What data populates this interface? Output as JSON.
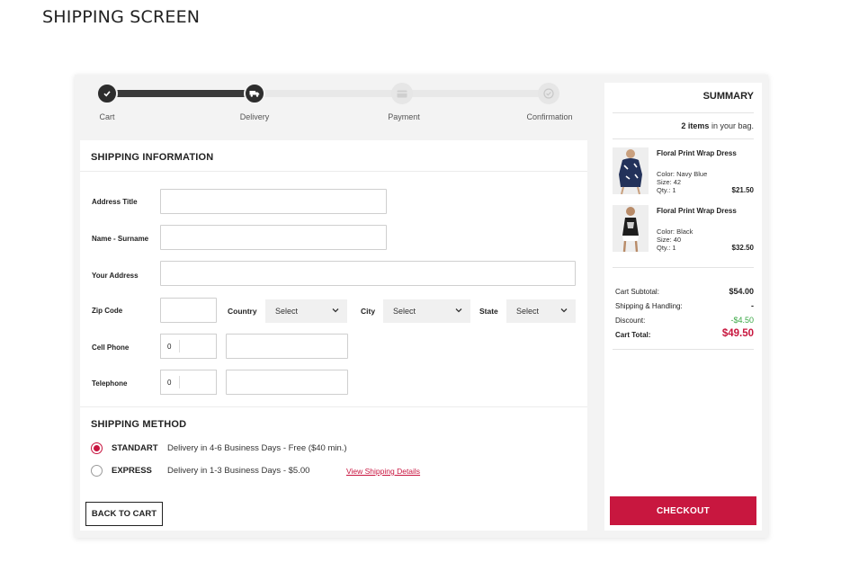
{
  "page": {
    "heading": "SHIPPING SCREEN"
  },
  "steps": [
    {
      "label": "Cart",
      "state": "done",
      "icon": "check-icon"
    },
    {
      "label": "Delivery",
      "state": "current",
      "icon": "truck-icon"
    },
    {
      "label": "Payment",
      "state": "todo",
      "icon": "credit-card-icon"
    },
    {
      "label": "Confirmation",
      "state": "todo",
      "icon": "check-circle-icon"
    }
  ],
  "shipping_info": {
    "title": "SHIPPING INFORMATION",
    "address_title_label": "Address Title",
    "address_title_value": "",
    "name_label": "Name - Surname",
    "name_value": "",
    "address_label": "Your Address",
    "address_value": "",
    "zip_label": "Zip Code",
    "zip_value": "",
    "country_label": "Country",
    "country_value": "Select",
    "city_label": "City",
    "city_value": "Select",
    "state_label": "State",
    "state_value": "Select",
    "cell_label": "Cell Phone",
    "cell_prefix": "0",
    "cell_value": "",
    "tel_label": "Telephone",
    "tel_prefix": "0",
    "tel_value": ""
  },
  "shipping_method": {
    "title": "SHIPPING METHOD",
    "options": [
      {
        "name": "STANDART",
        "desc": "Delivery in 4-6 Business Days - Free ($40 min.)",
        "selected": true
      },
      {
        "name": "EXPRESS",
        "desc": "Delivery in 1-3 Business Days - $5.00",
        "selected": false
      }
    ],
    "details_link": "View Shipping Details"
  },
  "back_button": "BACK TO CART",
  "summary": {
    "title": "SUMMARY",
    "bag_count": "2 items",
    "bag_suffix": "in your bag.",
    "items": [
      {
        "name": "Floral Print Wrap Dress",
        "color": "Color: Navy Blue",
        "size": "Size:  42",
        "qty": "Qty.:  1",
        "price": "$21.50"
      },
      {
        "name": "Floral Print Wrap Dress",
        "color": "Color: Black",
        "size": "Size:  40",
        "qty": "Qty.:  1",
        "price": "$32.50"
      }
    ],
    "subtotal_label": "Cart Subtotal:",
    "subtotal_value": "$54.00",
    "shipping_label": "Shipping & Handling:",
    "shipping_value": "-",
    "discount_label": "Discount:",
    "discount_value": "-$4.50",
    "total_label": "Cart Total:",
    "total_value": "$49.50",
    "checkout": "CHECKOUT"
  },
  "colors": {
    "accent": "#c8173f",
    "discount": "#3aa845",
    "dark": "#2d2d2d"
  }
}
